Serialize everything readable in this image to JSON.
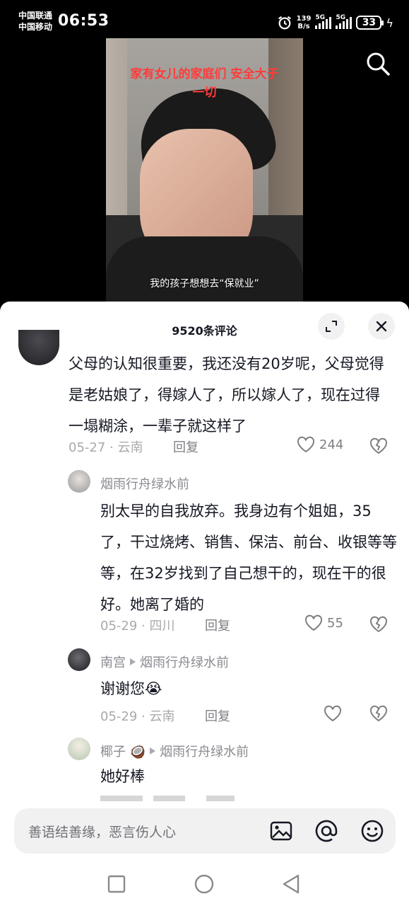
{
  "status_bar": {
    "carrier1": "中国联通",
    "carrier2": "中国移动",
    "time": "06:53",
    "net_speed_value": "139",
    "net_speed_unit": "B/s",
    "signal1_label": "5G",
    "signal2_label": "5G",
    "battery": "33"
  },
  "video": {
    "caption_top": "家有女儿的家庭们 安全大于一切",
    "caption_bottom": "我的孩子想想去“保就业”"
  },
  "comments_panel": {
    "title": "9520条评论",
    "comments": [
      {
        "text": "父母的认知很重要，我还没有20岁呢，父母觉得是老姑娘了，得嫁人了，所以嫁人了，现在过得一塌糊涂，一辈子就这样了",
        "date_loc": "05-27 · 云南",
        "reply": "回复",
        "likes": "244"
      },
      {
        "user": "烟雨行舟绿水前",
        "text": "别太早的自我放弃。我身边有个姐姐，35了，干过烧烤、销售、保洁、前台、收银等等等，在32岁找到了自己想干的，现在干的很好。她离了婚的",
        "date_loc": "05-29 · 四川",
        "reply": "回复",
        "likes": "55"
      },
      {
        "user": "南宫",
        "reply_to": "烟雨行舟绿水前",
        "text": "谢谢您😭",
        "date_loc": "05-29 · 云南",
        "reply": "回复",
        "likes": ""
      },
      {
        "user": "椰子 🥥",
        "reply_to": "烟雨行舟绿水前",
        "text": "她好棒",
        "date_loc": "",
        "reply": "",
        "likes": ""
      }
    ]
  },
  "input": {
    "placeholder": "善语结善缘，恶言伤人心"
  },
  "icons": {
    "search": "search-icon",
    "expand": "expand-icon",
    "close": "close-icon",
    "like": "heart-icon",
    "dislike": "broken-heart-icon",
    "image": "image-icon",
    "mention": "at-icon",
    "emoji": "emoji-icon"
  },
  "colors": {
    "caption_red": "#ff3b3b",
    "meta_gray": "#a9a9ad",
    "text_dark": "#161823"
  }
}
